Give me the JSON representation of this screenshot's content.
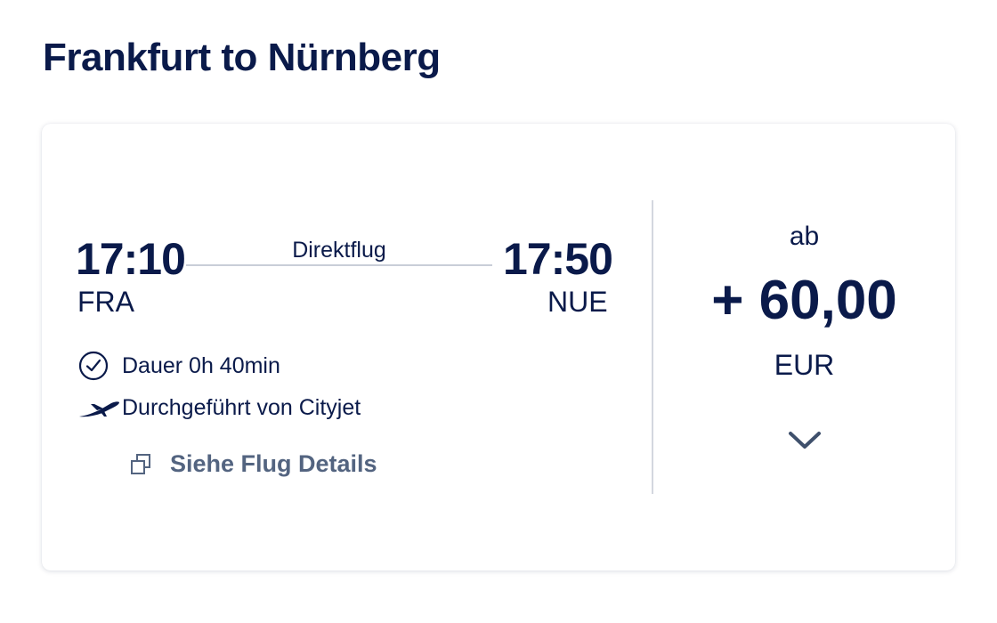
{
  "page": {
    "title": "Frankfurt to Nürnberg"
  },
  "flight": {
    "departure": {
      "time": "17:10",
      "airport": "FRA"
    },
    "arrival": {
      "time": "17:50",
      "airport": "NUE"
    },
    "route_label": "Direktflug",
    "duration": {
      "icon": "clock-icon",
      "text": "Dauer 0h 40min"
    },
    "operator": {
      "icon": "airplane-takeoff-icon",
      "text": "Durchgeführt von Cityjet"
    },
    "details_link": {
      "icon": "copy-icon",
      "label": "Siehe Flug Details"
    }
  },
  "price": {
    "prefix": "ab",
    "amount": "+ 60,00",
    "currency": "EUR",
    "expand_icon": "chevron-down-icon"
  },
  "colors": {
    "primary": "#0a1a4a",
    "link": "#536480",
    "divider": "#d3d7df",
    "background": "#ffffff"
  }
}
